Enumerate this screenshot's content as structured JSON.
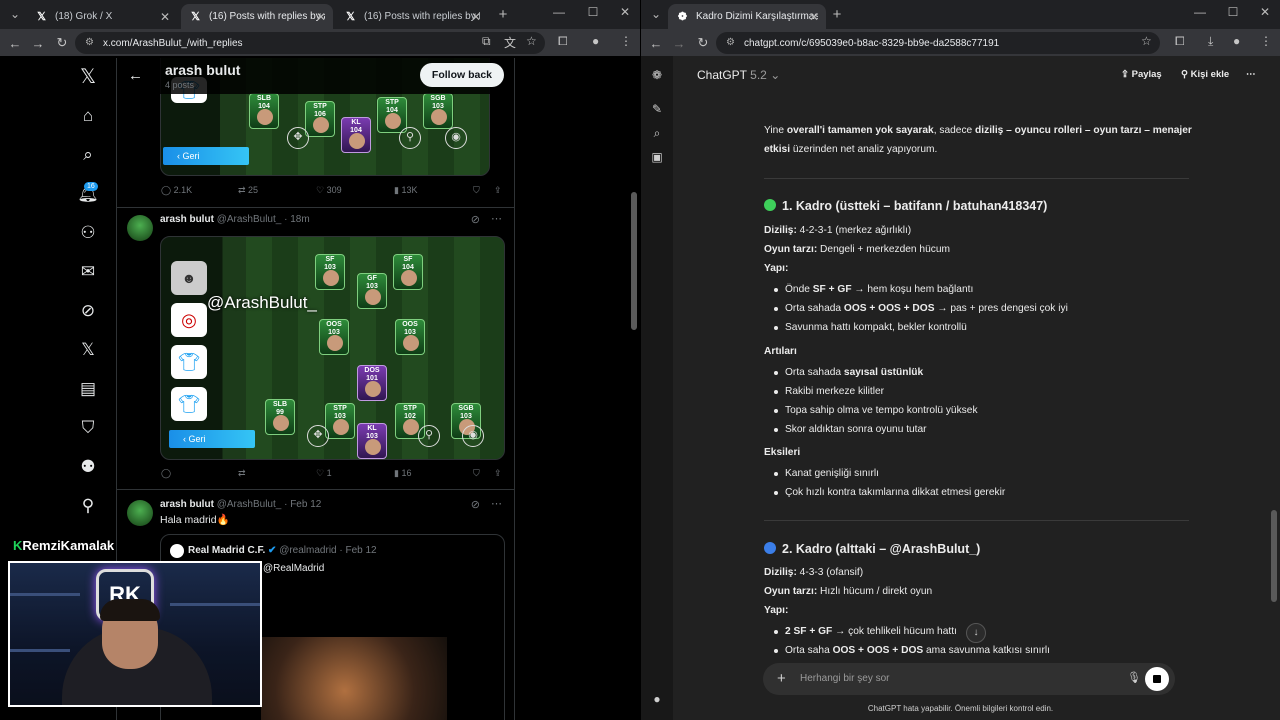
{
  "left_browser": {
    "tabs": [
      {
        "title": "(18) Grok / X"
      },
      {
        "title": "(16) Posts with replies by arash"
      },
      {
        "title": "(16) Posts with replies by Batifa"
      }
    ],
    "url": "x.com/ArashBulut_/with_replies"
  },
  "x_profile": {
    "name": "arash bulut",
    "posts_count": "4 posts",
    "follow_back": "Follow back",
    "notification_badge": "16",
    "post1_stats": {
      "replies": "2.1K",
      "reposts": "25",
      "likes": "309",
      "views": "13K"
    },
    "post2": {
      "name": "arash bulut",
      "handle": "@ArashBulut_ · 18m",
      "watermark": "@ArashBulut_",
      "stats": {
        "likes": "1",
        "views": "16"
      }
    },
    "post3": {
      "name": "arash bulut",
      "handle": "@ArashBulut_ · Feb 12",
      "text": "Hala madrid🔥",
      "quote": {
        "name": "Real Madrid C.F.",
        "handle": "@realmadrid · Feb 12",
        "text": "@RealMadrid"
      }
    },
    "geri_label": "Geri",
    "cards_top": [
      {
        "pos": "SLB",
        "ovr": "104"
      },
      {
        "pos": "STP",
        "ovr": "106"
      },
      {
        "pos": "KL",
        "ovr": "104"
      },
      {
        "pos": "STP",
        "ovr": "104"
      },
      {
        "pos": "SGB",
        "ovr": "103"
      }
    ],
    "cards_main": [
      {
        "pos": "SF",
        "ovr": "103"
      },
      {
        "pos": "SF",
        "ovr": "104"
      },
      {
        "pos": "GF",
        "ovr": "103"
      },
      {
        "pos": "OOS",
        "ovr": "103"
      },
      {
        "pos": "OOS",
        "ovr": "103"
      },
      {
        "pos": "DOS",
        "ovr": "101"
      },
      {
        "pos": "SLB",
        "ovr": "99"
      },
      {
        "pos": "STP",
        "ovr": "103"
      },
      {
        "pos": "STP",
        "ovr": "102"
      },
      {
        "pos": "KL",
        "ovr": "103"
      },
      {
        "pos": "SGB",
        "ovr": "103"
      }
    ]
  },
  "streamer": {
    "k": "K",
    "name": "RemziKamalak",
    "cam_logo": "RK"
  },
  "right_browser": {
    "tab_title": "Kadro Dizimi Karşılaştırması",
    "url": "chatgpt.com/c/695039e0-b8ac-8329-bb9e-da2588c77191"
  },
  "chatgpt": {
    "model": "ChatGPT",
    "version": "5.2",
    "share": "Paylaş",
    "add_person": "Kişi ekle",
    "intro": {
      "p1": "Yine ",
      "b1": "overall'i tamamen yok sayarak",
      ",": ",",
      "p2": " sadece ",
      "b2": "diziliş – oyuncu rolleri – oyun tarzı – menajer",
      "b3": "etkisi",
      "p3": " üzerinden net analiz yapıyorum."
    },
    "k1": {
      "title": "1. Kadro (üstteki – batifann / batuhan418347)",
      "dizilis_l": "Diziliş:",
      "dizilis": " 4-2-3-1 (merkez ağırlıklı)",
      "tarz_l": "Oyun tarzı:",
      "tarz": " Dengeli + merkezden hücum",
      "yapi": "Yapı:",
      "yapi_items": [
        {
          "pre": "Önde ",
          "b": "SF + GF",
          "post": " → hem koşu hem bağlantı"
        },
        {
          "pre": "Orta sahada ",
          "b": "OOS + OOS + DOS",
          "post": " → pas + pres dengesi çok iyi"
        },
        {
          "pre": "Savunma hattı kompakt, bekler kontrollü",
          "b": "",
          "post": ""
        }
      ],
      "artilar": "Artıları",
      "arti_items": [
        {
          "pre": "Orta sahada ",
          "b": "sayısal üstünlük",
          "post": ""
        },
        {
          "pre": "Rakibi merkeze kilitler",
          "b": "",
          "post": ""
        },
        {
          "pre": "Topa sahip olma ve tempo kontrolü yüksek",
          "b": "",
          "post": ""
        },
        {
          "pre": "Skor aldıktan sonra oyunu tutar",
          "b": "",
          "post": ""
        }
      ],
      "eksiler": "Eksileri",
      "eksi_items": [
        {
          "pre": "Kanat genişliği sınırlı"
        },
        {
          "pre": "Çok hızlı kontra takımlarına dikkat etmesi gerekir"
        }
      ]
    },
    "k2": {
      "title": "2. Kadro (alttaki – @ArashBulut_)",
      "dizilis_l": "Diziliş:",
      "dizilis": " 4-3-3 (ofansif)",
      "tarz_l": "Oyun tarzı:",
      "tarz": " Hızlı hücum / direkt oyun",
      "yapi": "Yapı:",
      "yapi_items": [
        {
          "pre": "",
          "b": "2 SF + GF",
          "post": " → çok tehlikeli hücum hattı"
        },
        {
          "pre": "Orta saha ",
          "b": "OOS + OOS + DOS",
          "post": " ama savunma katkısı sınırlı"
        }
      ]
    },
    "composer_placeholder": "Herhangi bir şey sor",
    "disclaimer": "ChatGPT hata yapabilir. Önemli bilgileri kontrol edin."
  }
}
